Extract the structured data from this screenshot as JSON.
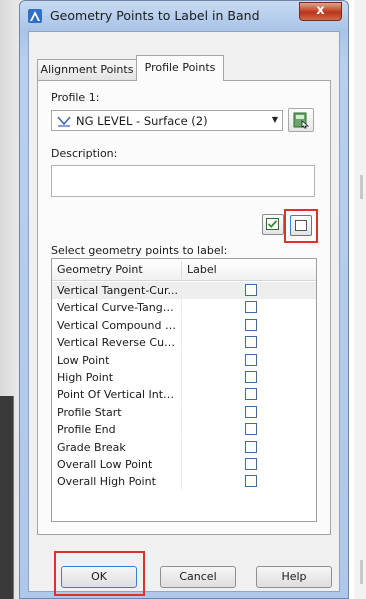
{
  "window": {
    "title": "Geometry Points to Label in Band",
    "close_glyph": "x"
  },
  "tabs": [
    {
      "label": "Alignment Points",
      "active": false
    },
    {
      "label": "Profile Points",
      "active": true
    }
  ],
  "profile": {
    "label": "Profile 1:",
    "selected": "NG LEVEL - Surface (2)"
  },
  "description": {
    "label": "Description:",
    "value": ""
  },
  "list": {
    "label": "Select geometry points to label:",
    "columns": [
      "Geometry Point",
      "Label"
    ],
    "rows": [
      {
        "name": "Vertical Tangent-Cur...",
        "checked": false
      },
      {
        "name": "Vertical Curve-Tange...",
        "checked": false
      },
      {
        "name": "Vertical Compound C...",
        "checked": false
      },
      {
        "name": "Vertical Reverse Curv...",
        "checked": false
      },
      {
        "name": "Low Point",
        "checked": false
      },
      {
        "name": "High Point",
        "checked": false
      },
      {
        "name": "Point Of Vertical Inter...",
        "checked": false
      },
      {
        "name": "Profile Start",
        "checked": false
      },
      {
        "name": "Profile End",
        "checked": false
      },
      {
        "name": "Grade Break",
        "checked": false
      },
      {
        "name": "Overall Low Point",
        "checked": false
      },
      {
        "name": "Overall High Point",
        "checked": false
      }
    ]
  },
  "buttons": {
    "ok": "OK",
    "cancel": "Cancel",
    "help": "Help"
  },
  "colors": {
    "highlight": "#d9332a",
    "titlebar": "#b8cfee",
    "close": "#c6482b"
  }
}
